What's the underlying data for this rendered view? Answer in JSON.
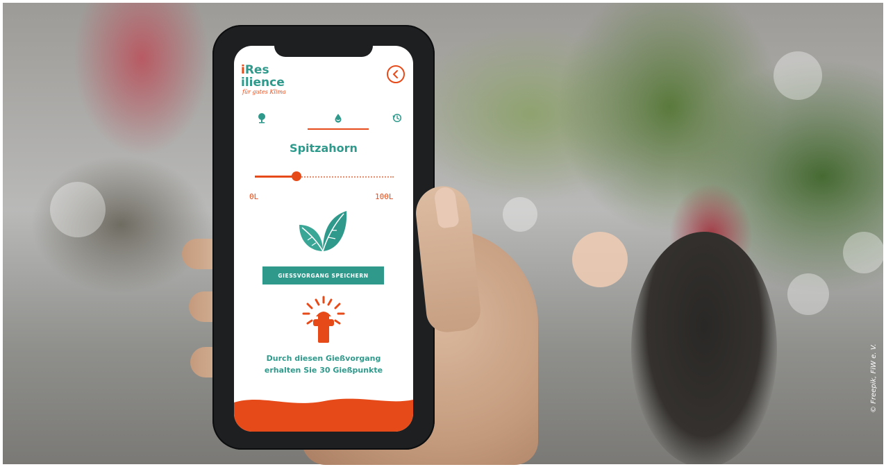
{
  "app": {
    "logo": {
      "line1_accent": "i",
      "line1_rest": "Res",
      "line2": "ilience",
      "tagline": "für gutes Klima"
    },
    "back_icon": "chevron-left-icon",
    "tabs": [
      {
        "icon": "tree-pin-icon"
      },
      {
        "icon": "water-drop-icon",
        "active": true
      },
      {
        "icon": "history-icon"
      }
    ],
    "tree_name": "Spitzahorn",
    "watering_slider": {
      "min_label": "0L",
      "max_label": "100L",
      "value_fraction": 0.3
    },
    "leaves_icon": "leaves-icon",
    "save_button_label": "GIESSVORGANG SPEICHERN",
    "hydrant_icon": "hydrant-icon",
    "points_message_line1": "Durch diesen Gießvorgang",
    "points_message_line2": "erhalten Sie 30 Gießpunkte"
  },
  "colors": {
    "teal": "#2f9a8c",
    "orange": "#e64a19"
  },
  "credit": "© Freepik, FiW e. V."
}
